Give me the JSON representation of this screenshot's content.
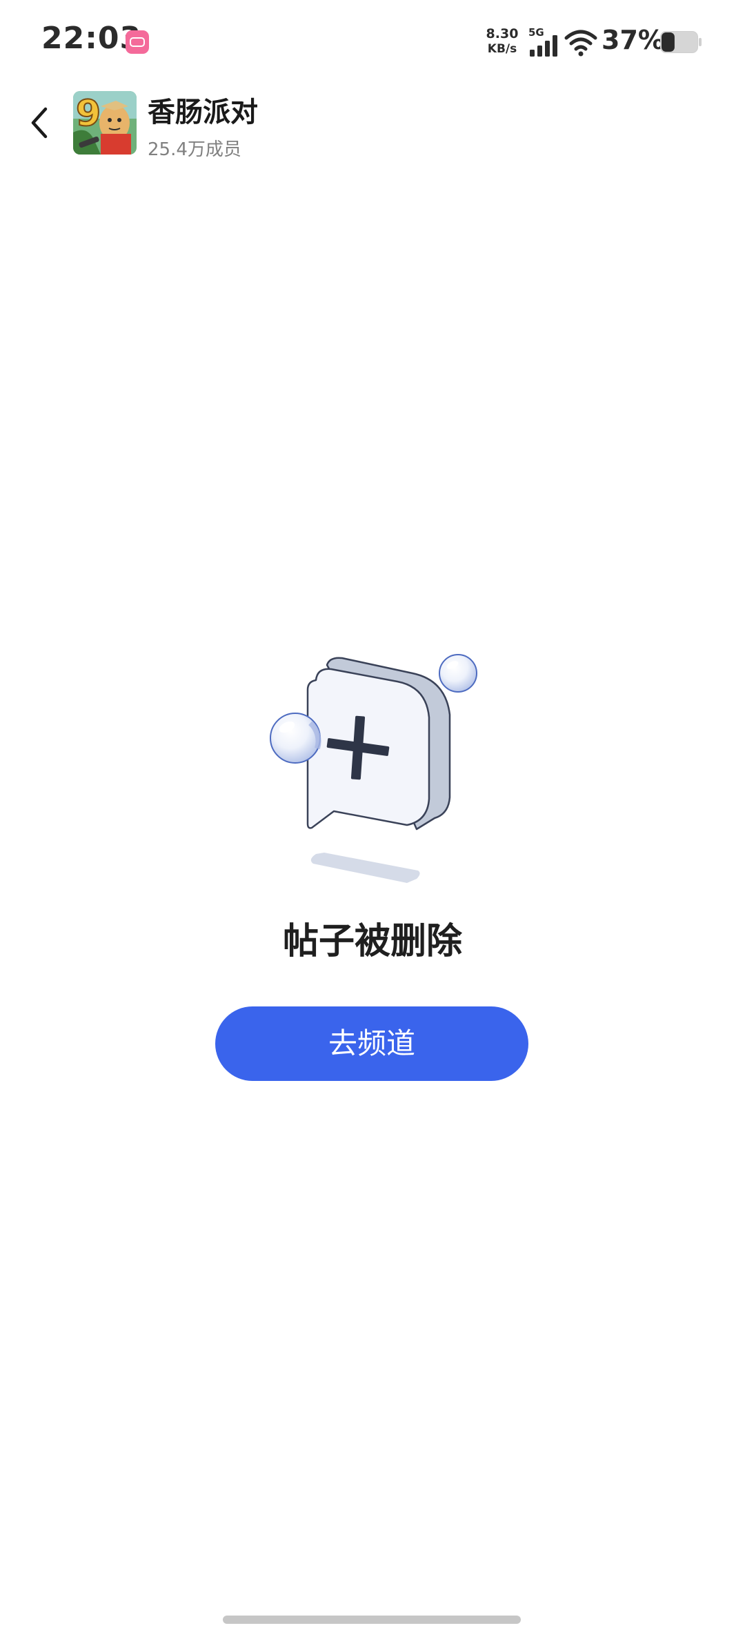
{
  "status_bar": {
    "time": "22:03",
    "net_speed_value": "8.30",
    "net_speed_unit": "KB/s",
    "network_type": "5G",
    "battery_percent": "37%",
    "battery_level": 0.37,
    "notification_app_icon": "bilibili-icon"
  },
  "header": {
    "back_icon": "chevron-left-icon",
    "channel_name": "香肠派对",
    "member_count": "25.4万成员"
  },
  "empty_state": {
    "illustration_icon": "chat-bubble-plus-icon",
    "title": "帖子被删除",
    "button_label": "去频道"
  },
  "colors": {
    "accent": "#3a64ec",
    "button_text": "#ffffff",
    "title_text": "#1f1f1f",
    "secondary_text": "#808080"
  }
}
